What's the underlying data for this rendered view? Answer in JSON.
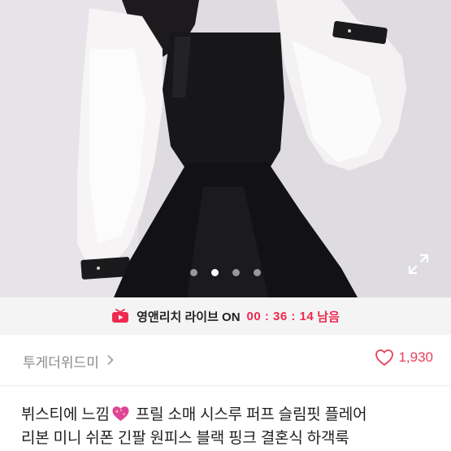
{
  "gallery": {
    "page_count": 4,
    "current_page": 2
  },
  "live_banner": {
    "text": "영앤리치 라이브 ON",
    "timer": "00 : 36 : 14",
    "remaining_label": "남음",
    "icon": "live-play-icon",
    "accent_color": "#ee2a4f"
  },
  "seller": {
    "name": "투게더위드미",
    "arrow_icon": "chevron-right-icon"
  },
  "likes": {
    "count": "1,930",
    "icon": "heart-outline-icon",
    "color": "#e8405f"
  },
  "product": {
    "title_line1_a": "뷔스티에 느낌",
    "title_line1_b": " 프릴 소매 시스루 퍼프 슬림핏 플레어",
    "title_line2": "리본 미니 쉬폰 긴팔 원피스 블랙 핑크 결혼식 하객룩",
    "emoji": "sparkling-heart-icon"
  }
}
